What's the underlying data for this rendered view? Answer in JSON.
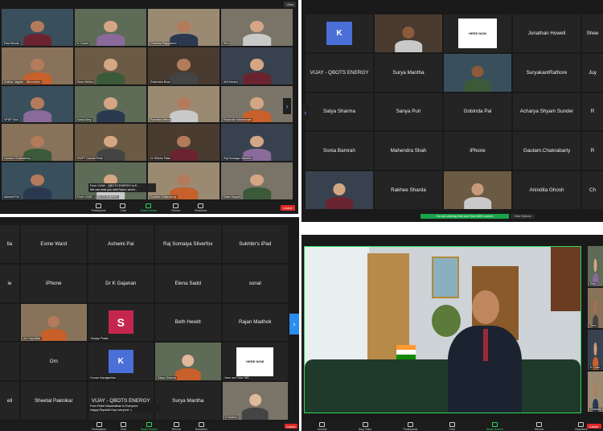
{
  "colors": {
    "end_button": "#e02828",
    "share_banner": "#1aa34a",
    "speaker_border": "#2dd65c",
    "panel": "#1a1a1a",
    "tile": "#242424"
  },
  "q1": {
    "tiles": [
      {
        "label": "Ravi Bende"
      },
      {
        "label": "K Chand"
      },
      {
        "label": "Chandra Rajapakshi"
      },
      {
        "label": "Shri"
      },
      {
        "label": "Sridhar Jagdan - Microvision"
      },
      {
        "label": "Kiran Mehta"
      },
      {
        "label": "Rashmika Bose"
      },
      {
        "label": "Arif Ahmed"
      },
      {
        "label": "VPSP Sinh"
      },
      {
        "label": "Sonia Bery"
      },
      {
        "label": "Ramnika Mehra"
      },
      {
        "label": "Ravinolle Kamboinath"
      },
      {
        "label": "Gautam Chakraborty"
      },
      {
        "label": "KWPT Gandhi Pulla"
      },
      {
        "label": "Dr Shikha Palta"
      },
      {
        "label": "Raj Somaiya Silverfox"
      },
      {
        "label": "Ashwini Pai"
      },
      {
        "label": "From VIJAY - QBOTS ENERGY"
      },
      {
        "label": "Kavitha Chakraborty"
      },
      {
        "label": "Delta Sanyal"
      }
    ],
    "chat": {
      "line1": "From VIJAY - QBOTS ENERGY to E...",
      "line2": "We can hear you well Rahul, which..."
    },
    "toolbar": [
      {
        "label": "Participants"
      },
      {
        "label": "Chat"
      },
      {
        "label": "Share Screen"
      },
      {
        "label": "Record"
      },
      {
        "label": "Reactions"
      }
    ],
    "view_label": "View",
    "end_label": "Leave"
  },
  "q2": {
    "rows": [
      [
        {
          "type": "avatar",
          "letter": "K",
          "label": ""
        },
        {
          "type": "video",
          "label": ""
        },
        {
          "type": "logo",
          "text": "HERE NOW"
        },
        {
          "type": "name",
          "label": "Jonathan Howell"
        },
        {
          "type": "name",
          "label": "Shee"
        }
      ],
      [
        {
          "type": "name",
          "label": "VIJAY - QBOTS ENERGY"
        },
        {
          "type": "name",
          "label": "Surya Mantha"
        },
        {
          "type": "video",
          "label": ""
        },
        {
          "type": "name",
          "label": "SuryakantRathore"
        },
        {
          "type": "name",
          "label": "Juy"
        }
      ],
      [
        {
          "type": "name",
          "label": "Satya Sharma"
        },
        {
          "type": "name",
          "label": "Sanya Puri"
        },
        {
          "type": "name",
          "label": "Gobinda Pal"
        },
        {
          "type": "name",
          "label": "Acharya Shyam Sunder"
        },
        {
          "type": "name",
          "label": "R"
        }
      ],
      [
        {
          "type": "name",
          "label": "Sonia Bamrah"
        },
        {
          "type": "name",
          "label": "Mahendra Shah"
        },
        {
          "type": "name",
          "label": "iPhone"
        },
        {
          "type": "name",
          "label": "Gautam.Chakrabarty"
        },
        {
          "type": "name",
          "label": "R"
        }
      ],
      [
        {
          "type": "video",
          "label": ""
        },
        {
          "type": "name",
          "label": "Rakhee Sharda"
        },
        {
          "type": "video",
          "label": ""
        },
        {
          "type": "name",
          "label": "Anindita Ghosh"
        },
        {
          "type": "name",
          "label": "Ch"
        }
      ]
    ],
    "share_banner": "You are viewing Host and Host 0BE's screen",
    "view_options": "View Options"
  },
  "q3": {
    "rows": [
      [
        {
          "type": "name",
          "label": "lla"
        },
        {
          "type": "name",
          "label": "Esme Ward"
        },
        {
          "type": "name",
          "label": "Ashwini Pai"
        },
        {
          "type": "name",
          "label": "Raj Somaiya Silverfox"
        },
        {
          "type": "name",
          "label": "Sukhbir's iPad"
        }
      ],
      [
        {
          "type": "name",
          "label": "ie"
        },
        {
          "type": "name",
          "label": "iPhone"
        },
        {
          "type": "name",
          "label": "Dr K Gajanan"
        },
        {
          "type": "name",
          "label": "Elena Sadd"
        },
        {
          "type": "name",
          "label": "sonal"
        }
      ],
      [
        {
          "type": "name",
          "label": ""
        },
        {
          "type": "video",
          "label": "Ani Kapridkar"
        },
        {
          "type": "avatar",
          "letter": "S",
          "label": "Sanjay Phatia"
        },
        {
          "type": "name",
          "label": "Beth Hewitt"
        },
        {
          "type": "name",
          "label": "Rajan Madhok"
        }
      ],
      [
        {
          "type": "name",
          "label": ""
        },
        {
          "type": "name",
          "label": "Om"
        },
        {
          "type": "avatar",
          "letter": "K",
          "label": "Kumar Kamajanikar"
        },
        {
          "type": "video",
          "label": "Satya Sharma"
        },
        {
          "type": "logo",
          "text": "HERE NOW",
          "label": "Here and Now 365"
        }
      ],
      [
        {
          "type": "name",
          "label": "ell"
        },
        {
          "type": "name",
          "label": "Sheetal Paknikar"
        },
        {
          "type": "name",
          "label": "VIJAY - QBOTS ENERGY"
        },
        {
          "type": "name",
          "label": "Surya Mantha"
        },
        {
          "type": "video",
          "label": "JI Bartum"
        }
      ]
    ],
    "chat": {
      "line1": "From Riddi Viswanathan to Everyone:",
      "line2": "Happy Republic Day everyone :)"
    },
    "toolbar": [
      {
        "label": "Participants"
      },
      {
        "label": "Chat"
      },
      {
        "label": "Share Screen"
      },
      {
        "label": "Record"
      },
      {
        "label": "Reactions"
      }
    ],
    "end_label": "Leave"
  },
  "q4": {
    "side_labels": [
      "Ram",
      "Rani",
      "K Chan",
      "Chandra"
    ],
    "toolbar": [
      {
        "label": "Unmute"
      },
      {
        "label": "Stop Video"
      },
      {
        "label": "Participants"
      },
      {
        "label": "Chat"
      },
      {
        "label": "Share Screen"
      },
      {
        "label": "Record"
      },
      {
        "label": "Reactions"
      }
    ],
    "end_label": "Leave"
  }
}
